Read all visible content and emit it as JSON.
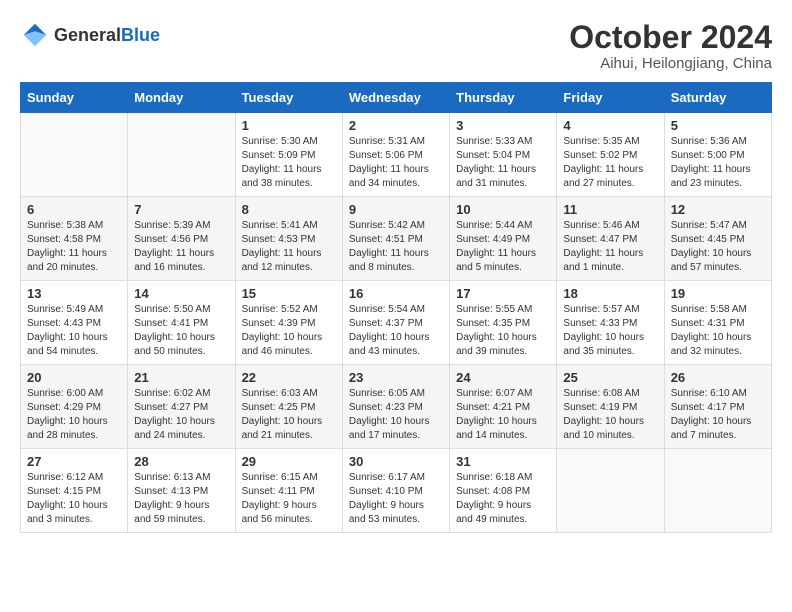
{
  "logo": {
    "general": "General",
    "blue": "Blue"
  },
  "header": {
    "month": "October 2024",
    "location": "Aihui, Heilongjiang, China"
  },
  "weekdays": [
    "Sunday",
    "Monday",
    "Tuesday",
    "Wednesday",
    "Thursday",
    "Friday",
    "Saturday"
  ],
  "weeks": [
    [
      {
        "day": "",
        "sunrise": "",
        "sunset": "",
        "daylight": ""
      },
      {
        "day": "",
        "sunrise": "",
        "sunset": "",
        "daylight": ""
      },
      {
        "day": "1",
        "sunrise": "Sunrise: 5:30 AM",
        "sunset": "Sunset: 5:09 PM",
        "daylight": "Daylight: 11 hours and 38 minutes."
      },
      {
        "day": "2",
        "sunrise": "Sunrise: 5:31 AM",
        "sunset": "Sunset: 5:06 PM",
        "daylight": "Daylight: 11 hours and 34 minutes."
      },
      {
        "day": "3",
        "sunrise": "Sunrise: 5:33 AM",
        "sunset": "Sunset: 5:04 PM",
        "daylight": "Daylight: 11 hours and 31 minutes."
      },
      {
        "day": "4",
        "sunrise": "Sunrise: 5:35 AM",
        "sunset": "Sunset: 5:02 PM",
        "daylight": "Daylight: 11 hours and 27 minutes."
      },
      {
        "day": "5",
        "sunrise": "Sunrise: 5:36 AM",
        "sunset": "Sunset: 5:00 PM",
        "daylight": "Daylight: 11 hours and 23 minutes."
      }
    ],
    [
      {
        "day": "6",
        "sunrise": "Sunrise: 5:38 AM",
        "sunset": "Sunset: 4:58 PM",
        "daylight": "Daylight: 11 hours and 20 minutes."
      },
      {
        "day": "7",
        "sunrise": "Sunrise: 5:39 AM",
        "sunset": "Sunset: 4:56 PM",
        "daylight": "Daylight: 11 hours and 16 minutes."
      },
      {
        "day": "8",
        "sunrise": "Sunrise: 5:41 AM",
        "sunset": "Sunset: 4:53 PM",
        "daylight": "Daylight: 11 hours and 12 minutes."
      },
      {
        "day": "9",
        "sunrise": "Sunrise: 5:42 AM",
        "sunset": "Sunset: 4:51 PM",
        "daylight": "Daylight: 11 hours and 8 minutes."
      },
      {
        "day": "10",
        "sunrise": "Sunrise: 5:44 AM",
        "sunset": "Sunset: 4:49 PM",
        "daylight": "Daylight: 11 hours and 5 minutes."
      },
      {
        "day": "11",
        "sunrise": "Sunrise: 5:46 AM",
        "sunset": "Sunset: 4:47 PM",
        "daylight": "Daylight: 11 hours and 1 minute."
      },
      {
        "day": "12",
        "sunrise": "Sunrise: 5:47 AM",
        "sunset": "Sunset: 4:45 PM",
        "daylight": "Daylight: 10 hours and 57 minutes."
      }
    ],
    [
      {
        "day": "13",
        "sunrise": "Sunrise: 5:49 AM",
        "sunset": "Sunset: 4:43 PM",
        "daylight": "Daylight: 10 hours and 54 minutes."
      },
      {
        "day": "14",
        "sunrise": "Sunrise: 5:50 AM",
        "sunset": "Sunset: 4:41 PM",
        "daylight": "Daylight: 10 hours and 50 minutes."
      },
      {
        "day": "15",
        "sunrise": "Sunrise: 5:52 AM",
        "sunset": "Sunset: 4:39 PM",
        "daylight": "Daylight: 10 hours and 46 minutes."
      },
      {
        "day": "16",
        "sunrise": "Sunrise: 5:54 AM",
        "sunset": "Sunset: 4:37 PM",
        "daylight": "Daylight: 10 hours and 43 minutes."
      },
      {
        "day": "17",
        "sunrise": "Sunrise: 5:55 AM",
        "sunset": "Sunset: 4:35 PM",
        "daylight": "Daylight: 10 hours and 39 minutes."
      },
      {
        "day": "18",
        "sunrise": "Sunrise: 5:57 AM",
        "sunset": "Sunset: 4:33 PM",
        "daylight": "Daylight: 10 hours and 35 minutes."
      },
      {
        "day": "19",
        "sunrise": "Sunrise: 5:58 AM",
        "sunset": "Sunset: 4:31 PM",
        "daylight": "Daylight: 10 hours and 32 minutes."
      }
    ],
    [
      {
        "day": "20",
        "sunrise": "Sunrise: 6:00 AM",
        "sunset": "Sunset: 4:29 PM",
        "daylight": "Daylight: 10 hours and 28 minutes."
      },
      {
        "day": "21",
        "sunrise": "Sunrise: 6:02 AM",
        "sunset": "Sunset: 4:27 PM",
        "daylight": "Daylight: 10 hours and 24 minutes."
      },
      {
        "day": "22",
        "sunrise": "Sunrise: 6:03 AM",
        "sunset": "Sunset: 4:25 PM",
        "daylight": "Daylight: 10 hours and 21 minutes."
      },
      {
        "day": "23",
        "sunrise": "Sunrise: 6:05 AM",
        "sunset": "Sunset: 4:23 PM",
        "daylight": "Daylight: 10 hours and 17 minutes."
      },
      {
        "day": "24",
        "sunrise": "Sunrise: 6:07 AM",
        "sunset": "Sunset: 4:21 PM",
        "daylight": "Daylight: 10 hours and 14 minutes."
      },
      {
        "day": "25",
        "sunrise": "Sunrise: 6:08 AM",
        "sunset": "Sunset: 4:19 PM",
        "daylight": "Daylight: 10 hours and 10 minutes."
      },
      {
        "day": "26",
        "sunrise": "Sunrise: 6:10 AM",
        "sunset": "Sunset: 4:17 PM",
        "daylight": "Daylight: 10 hours and 7 minutes."
      }
    ],
    [
      {
        "day": "27",
        "sunrise": "Sunrise: 6:12 AM",
        "sunset": "Sunset: 4:15 PM",
        "daylight": "Daylight: 10 hours and 3 minutes."
      },
      {
        "day": "28",
        "sunrise": "Sunrise: 6:13 AM",
        "sunset": "Sunset: 4:13 PM",
        "daylight": "Daylight: 9 hours and 59 minutes."
      },
      {
        "day": "29",
        "sunrise": "Sunrise: 6:15 AM",
        "sunset": "Sunset: 4:11 PM",
        "daylight": "Daylight: 9 hours and 56 minutes."
      },
      {
        "day": "30",
        "sunrise": "Sunrise: 6:17 AM",
        "sunset": "Sunset: 4:10 PM",
        "daylight": "Daylight: 9 hours and 53 minutes."
      },
      {
        "day": "31",
        "sunrise": "Sunrise: 6:18 AM",
        "sunset": "Sunset: 4:08 PM",
        "daylight": "Daylight: 9 hours and 49 minutes."
      },
      {
        "day": "",
        "sunrise": "",
        "sunset": "",
        "daylight": ""
      },
      {
        "day": "",
        "sunrise": "",
        "sunset": "",
        "daylight": ""
      }
    ]
  ]
}
